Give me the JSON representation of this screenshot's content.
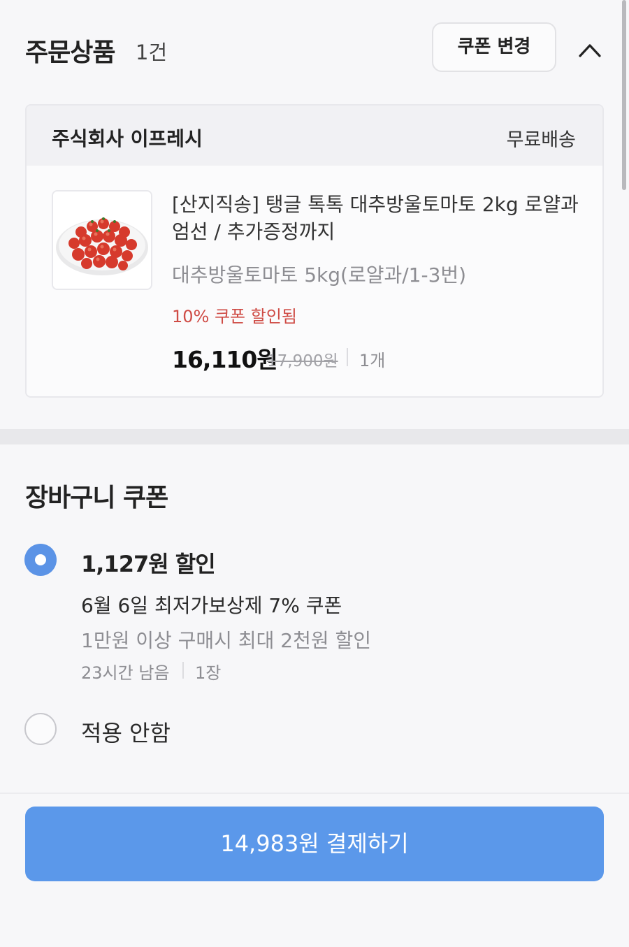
{
  "order": {
    "title": "주문상품",
    "count": "1건",
    "coupon_change_label": "쿠폰 변경",
    "collapse_icon": "chevron-up-icon"
  },
  "product_card": {
    "seller": "주식회사 이프레시",
    "shipping": "무료배송",
    "product": {
      "name": "[산지직송] 탱글 톡톡 대추방울토마토 2kg 로얄과 엄선 / 추가증정까지",
      "option": "대추방울토마토 5kg(로얄과/1-3번)",
      "discount_text": "10% 쿠폰 할인됨",
      "price": "16,110원",
      "original_price": "17,900원",
      "quantity": "1개"
    }
  },
  "cart_coupon": {
    "title": "장바구니 쿠폰",
    "options": [
      {
        "amount": "1,127원 할인",
        "name": "6월 6일 최저가보상제 7% 쿠폰",
        "condition": "1만원 이상 구매시 최대 2천원 할인",
        "remaining": "23시간 남음",
        "count": "1장",
        "selected": true
      },
      {
        "label": "적용 안함",
        "selected": false
      }
    ]
  },
  "payment": {
    "button_label": "14,983원 결제하기"
  },
  "colors": {
    "accent": "#5b93e6",
    "discount_red": "#cf4b45",
    "pay_button": "#5b98ea"
  }
}
